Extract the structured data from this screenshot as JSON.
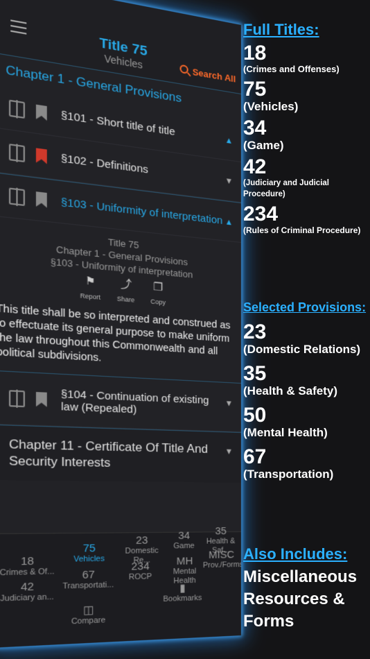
{
  "app": {
    "title": "Title 75",
    "subtitle": "Vehicles",
    "search_all": "Search All",
    "chapter_1": "Chapter 1 - General Provisions",
    "sections": [
      {
        "label": "§101 - Short title of title"
      },
      {
        "label": "§102 - Definitions"
      },
      {
        "label": "§103 - Uniformity of interpretation"
      },
      {
        "label": "§104 - Continuation of existing law (Repealed)"
      }
    ],
    "detail": {
      "line1": "Title 75",
      "line2": "Chapter 1 - General Provisions",
      "line3": "§103 - Uniformity of interpretation",
      "report": "Report",
      "share": "Share",
      "copy": "Copy",
      "body": "This title shall be so interpreted and construed as to effectuate its general purpose to make uniform the law throughout this Commonwealth and all political subdivisions."
    },
    "chapter_11": "Chapter 11 - Certificate Of Title And Security Interests",
    "tabs": [
      {
        "num": "18",
        "label": "Crimes & Of..."
      },
      {
        "num": "75",
        "label": "Vehicles"
      },
      {
        "num": "23",
        "label": "Domestic Re..."
      },
      {
        "num": "34",
        "label": "Game"
      },
      {
        "num": "35",
        "label": "Health & Saf..."
      },
      {
        "num": "42",
        "label": "Judiciary an..."
      },
      {
        "num": "67",
        "label": "Transportati..."
      },
      {
        "num": "234",
        "label": "ROCP"
      },
      {
        "num": "MH",
        "label": "Mental Health"
      },
      {
        "num": "MISC",
        "label": "Prov./Forms"
      },
      {
        "label": "Compare"
      },
      {
        "label": "Bookmarks"
      }
    ]
  },
  "side": {
    "full_titles_header": "Full Titles:",
    "full_titles": [
      {
        "num": "18",
        "desc": "(Crimes and Offenses)"
      },
      {
        "num": "75",
        "desc": "(Vehicles)"
      },
      {
        "num": "34",
        "desc": "(Game)"
      },
      {
        "num": "42",
        "desc": "(Judiciary and Judicial Procedure)"
      },
      {
        "num": "234",
        "desc": "(Rules of Criminal Procedure)"
      }
    ],
    "selected_header": "Selected Provisions:",
    "selected": [
      {
        "num": "23",
        "desc": "(Domestic Relations)"
      },
      {
        "num": "35",
        "desc": "(Health & Safety)"
      },
      {
        "num": "50",
        "desc": "(Mental Health)"
      },
      {
        "num": "67",
        "desc": "(Transportation)"
      }
    ],
    "also_header": "Also Includes:",
    "also_line1": "Miscellaneous",
    "also_line2": "Resources &",
    "also_line3": "Forms"
  },
  "colors": {
    "accent": "#28a8e6",
    "search": "#ff6a2a",
    "bookmark_active": "#d0392b",
    "header_blue": "#2bb0ff"
  }
}
